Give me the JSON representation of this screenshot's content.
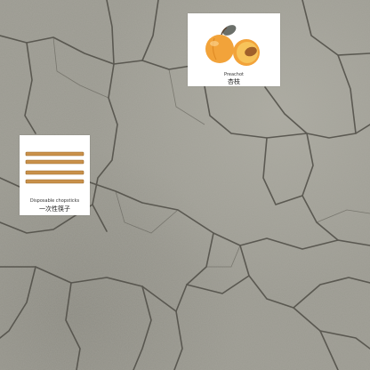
{
  "scene": {
    "background": "cracked-concrete-ground",
    "colors": {
      "stone_light": "#a9a89e",
      "stone_mid": "#94938a",
      "crack": "#4e4c45"
    }
  },
  "cards": {
    "apricot": {
      "icon": "apricot-icon",
      "caption_en": "Preachot",
      "caption_zh": "杏枝",
      "colors": {
        "fruit": "#f2a33a",
        "flesh": "#f7c35a",
        "pit": "#a0602a",
        "leaf": "#6b6f6a"
      }
    },
    "chopsticks": {
      "icon": "chopsticks-icon",
      "caption_en": "Disposable chopsticks",
      "caption_zh": "一次性筷子",
      "colors": {
        "stick": "#c9914a",
        "stick_edge": "#9c6a2c"
      }
    }
  }
}
